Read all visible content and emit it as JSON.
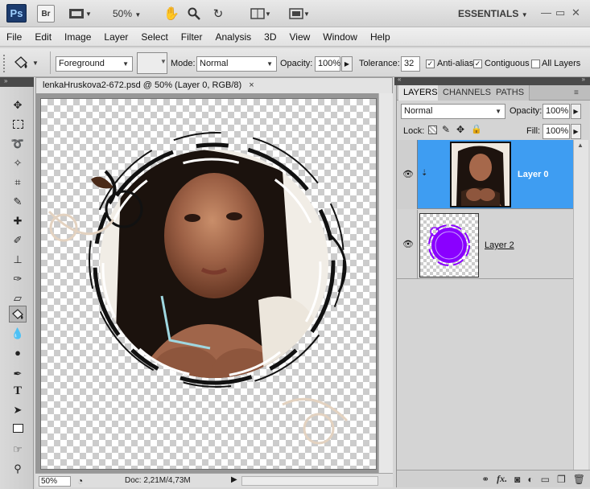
{
  "app": {
    "logo": "Ps",
    "bridge_label": "Br",
    "zoom": "50%",
    "workspace": "ESSENTIALS"
  },
  "menu": [
    "File",
    "Edit",
    "Image",
    "Layer",
    "Select",
    "Filter",
    "Analysis",
    "3D",
    "View",
    "Window",
    "Help"
  ],
  "options": {
    "fill_source": "Foreground",
    "mode_label": "Mode:",
    "mode_value": "Normal",
    "opacity_label": "Opacity:",
    "opacity_value": "100%",
    "tolerance_label": "Tolerance:",
    "tolerance_value": "32",
    "antialias_label": "Anti-alias",
    "antialias_checked": true,
    "contiguous_label": "Contiguous",
    "contiguous_checked": true,
    "alllayers_label": "All Layers",
    "alllayers_checked": false
  },
  "document": {
    "tab_title": "lenkaHruskova2-672.psd @ 50% (Layer 0, RGB/8)",
    "close": "×",
    "zoom_status": "50%",
    "doc_status": "Doc: 2,21M/4,73M"
  },
  "layers_panel": {
    "tabs": [
      "LAYERS",
      "CHANNELS",
      "PATHS"
    ],
    "blend_mode": "Normal",
    "opacity_label": "Opacity:",
    "opacity_value": "100%",
    "lock_label": "Lock:",
    "fill_label": "Fill:",
    "fill_value": "100%",
    "layers": [
      {
        "name": "Layer 0",
        "selected": true
      },
      {
        "name": "Layer 2",
        "selected": false
      }
    ]
  },
  "icons": {
    "tools": [
      "move-icon",
      "marquee-icon",
      "lasso-icon",
      "quick-select-icon",
      "crop-icon",
      "eyedropper-icon",
      "healing-icon",
      "brush-icon",
      "stamp-icon",
      "history-brush-icon",
      "eraser-icon",
      "paint-bucket-icon",
      "blur-icon",
      "dodge-icon",
      "pen-icon",
      "type-icon",
      "path-select-icon",
      "shape-icon",
      "hand-icon",
      "zoom-icon"
    ]
  },
  "colors": {
    "selection": "#3e9df2",
    "purple_layer": "#8a00ff"
  }
}
